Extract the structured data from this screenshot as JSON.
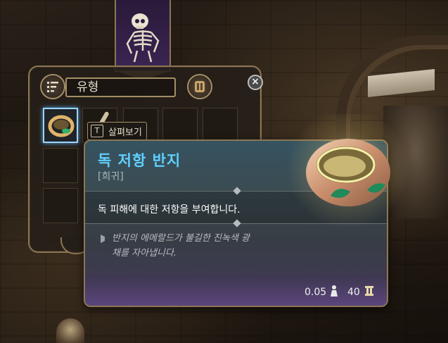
{
  "inventory": {
    "filter_label": "유형",
    "inspect_key": "T",
    "inspect_label": "살펴보기"
  },
  "tooltip": {
    "item_name": "독 저항 반지",
    "rarity": "[희귀]",
    "description": "독 피해에 대한 저항을 부여합니다.",
    "flavor_line1": "반지의 에메랄드가 불길한 진녹색 광",
    "flavor_line2": "채를 자아냅니다.",
    "weight": "0.05",
    "value": "40"
  },
  "colors": {
    "title": "#5fd0ff",
    "selected_slot": "#9ad4ff",
    "frame": "#8c7654"
  },
  "icons": {
    "filter": "filter-sort-icon",
    "equipment": "armor-equipment-icon",
    "close": "close-x-icon",
    "weight": "weight-icon",
    "value": "gold-coin-icon"
  }
}
